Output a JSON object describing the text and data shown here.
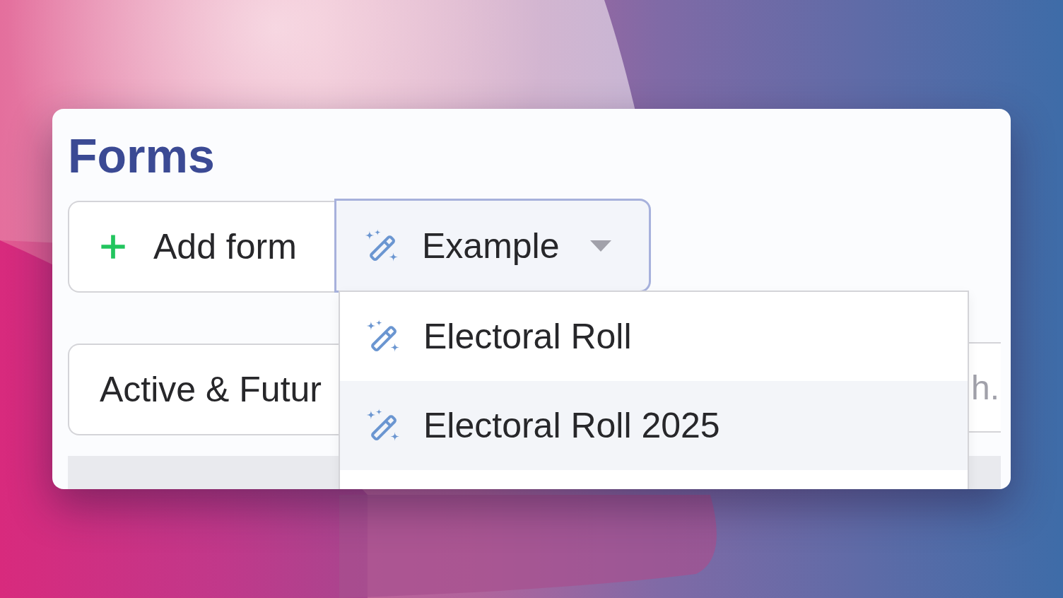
{
  "page": {
    "title": "Forms"
  },
  "toolbar": {
    "add_button": {
      "label": "Add form"
    },
    "example_button": {
      "label": "Example",
      "expanded": true
    }
  },
  "example_menu": {
    "items": [
      {
        "label": "Electoral Roll",
        "selected": false
      },
      {
        "label": "Electoral Roll 2025",
        "selected": true
      }
    ]
  },
  "filters": {
    "status_select": {
      "value": "Active & Futur"
    },
    "search": {
      "placeholder": "h."
    }
  }
}
